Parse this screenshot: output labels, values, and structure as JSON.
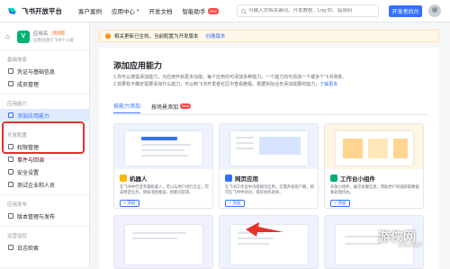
{
  "header": {
    "logo_text": "飞书开放平台",
    "nav": [
      {
        "label": "客户案例",
        "chevron": false,
        "badge": ""
      },
      {
        "label": "应用中心",
        "chevron": true,
        "badge": ""
      },
      {
        "label": "开发文档",
        "chevron": false,
        "badge": ""
      },
      {
        "label": "智能助手",
        "chevron": false,
        "badge": "new"
      }
    ],
    "search_placeholder": "可输入文档关键词、开发教程、Log ID、错误码",
    "dev_button": "开发者后台"
  },
  "sidebar": {
    "app_icon_letter": "V",
    "app_name": "应用名",
    "app_tag": "测试版",
    "app_sub": "应用创建于飞书个人版",
    "sections": [
      {
        "title": "基础信息",
        "items": [
          {
            "label": "凭证与基础信息",
            "active": false
          },
          {
            "label": "成员管理",
            "active": false
          }
        ]
      },
      {
        "title": "应用能力",
        "items": [
          {
            "label": "添加应用能力",
            "active": true
          }
        ]
      },
      {
        "title": "开发配置",
        "items": [
          {
            "label": "权限管理",
            "active": false
          },
          {
            "label": "事件与回调",
            "active": false
          },
          {
            "label": "安全设置",
            "active": false
          },
          {
            "label": "测试企业和人员",
            "active": false
          }
        ]
      },
      {
        "title": "应用发布",
        "items": [
          {
            "label": "版本管理与发布",
            "active": false
          }
        ]
      },
      {
        "title": "运营监控",
        "items": [
          {
            "label": "日志检索",
            "active": false
          }
        ]
      }
    ]
  },
  "banner": {
    "text": "相关更新已生效，当前配置为开发版本",
    "link": "创建版本"
  },
  "panel": {
    "title": "添加应用能力",
    "desc_line1": "1.你可以按需添加能力，为应用开启更多功能，每个应用均可添加多种能力，一个能力均可添加一个或多个飞书场景。",
    "desc_line2": "2.如果有不确定需要添加什么能力，可以到飞书开发者社区中查看教程，根据实际业务添加需要的能力，",
    "desc_link": "了解更多",
    "tabs": [
      {
        "label": "按能力添加",
        "active": true,
        "hot": ""
      },
      {
        "label": "按场景添加",
        "active": false,
        "hot": "New"
      }
    ],
    "cards": [
      {
        "title": "机器人",
        "icon_color": "#ffb400",
        "desc": "在飞书中打造专属机器人，可以与用户进行交互，完成特定任务，例如消息推送、智能问答等。",
        "add": "+ 添加"
      },
      {
        "title": "网页应用",
        "icon_color": "#3370ff",
        "desc": "在飞书工作台中内嵌网页应用，无需开发客户端，即可在飞书中访问，提升协作效率。",
        "add": "+ 添加"
      },
      {
        "title": "工作台小组件",
        "icon_color": "#00b26f",
        "desc": "开放小组件，展示关键信息，帮助用户快速获取数据和处理待办。",
        "add": "+ 添加"
      }
    ]
  },
  "watermark": {
    "main": "游侠网",
    "sub": "ALI213.NET"
  }
}
